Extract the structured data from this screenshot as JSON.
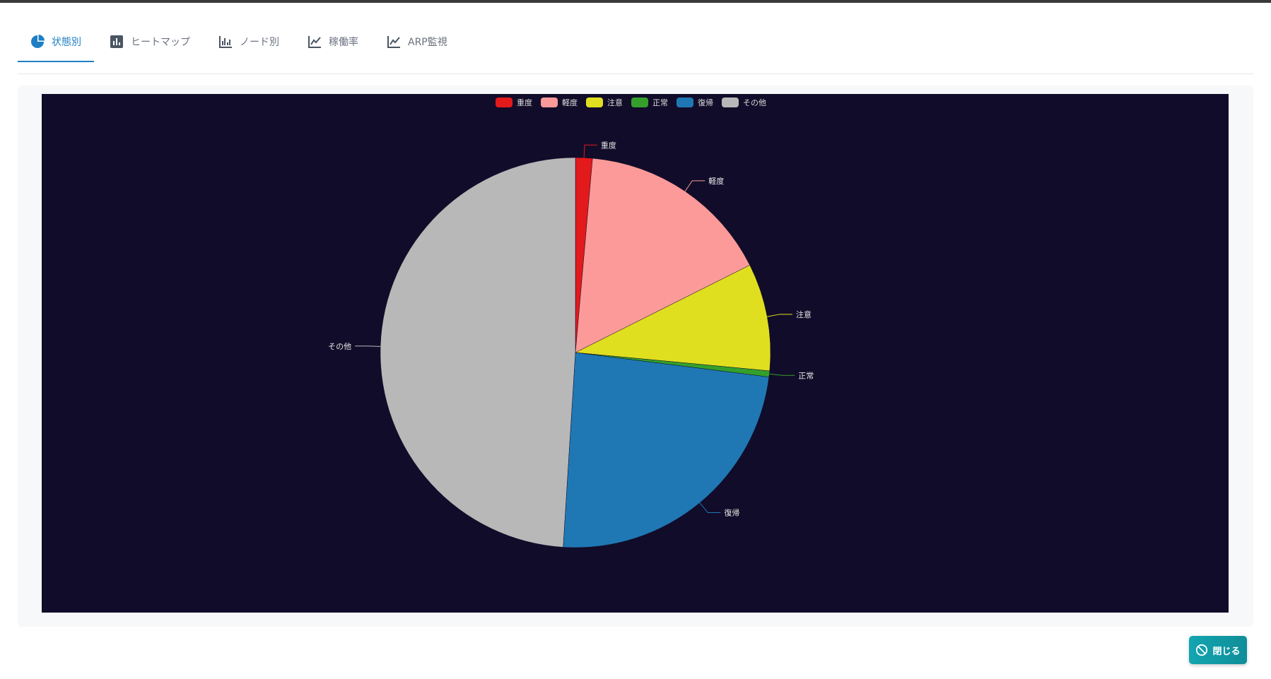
{
  "tabs": [
    {
      "label": "状態別",
      "icon": "pie-chart-icon",
      "active": true
    },
    {
      "label": "ヒートマップ",
      "icon": "bar-chart-icon",
      "active": false
    },
    {
      "label": "ノード別",
      "icon": "grouped-bar-icon",
      "active": false
    },
    {
      "label": "稼働率",
      "icon": "line-chart-icon",
      "active": false
    },
    {
      "label": "ARP監視",
      "icon": "line-chart-icon",
      "active": false
    }
  ],
  "close_button": {
    "label": "閉じる",
    "icon": "no-entry-icon"
  },
  "colors": {
    "accent": "#1f7fc4",
    "chart_background": "#110c29",
    "close_button": "#13a5b0"
  },
  "chart_data": {
    "type": "pie",
    "legend_position": "top",
    "labels": [
      "重度",
      "軽度",
      "注意",
      "正常",
      "復帰",
      "その他"
    ],
    "values": [
      1.4,
      16.2,
      8.9,
      0.5,
      24.0,
      49.0
    ],
    "colors": [
      "#e21a1c",
      "#fb9a99",
      "#dfdf1f",
      "#34a02b",
      "#1f78b4",
      "#b8b8b8"
    ]
  }
}
